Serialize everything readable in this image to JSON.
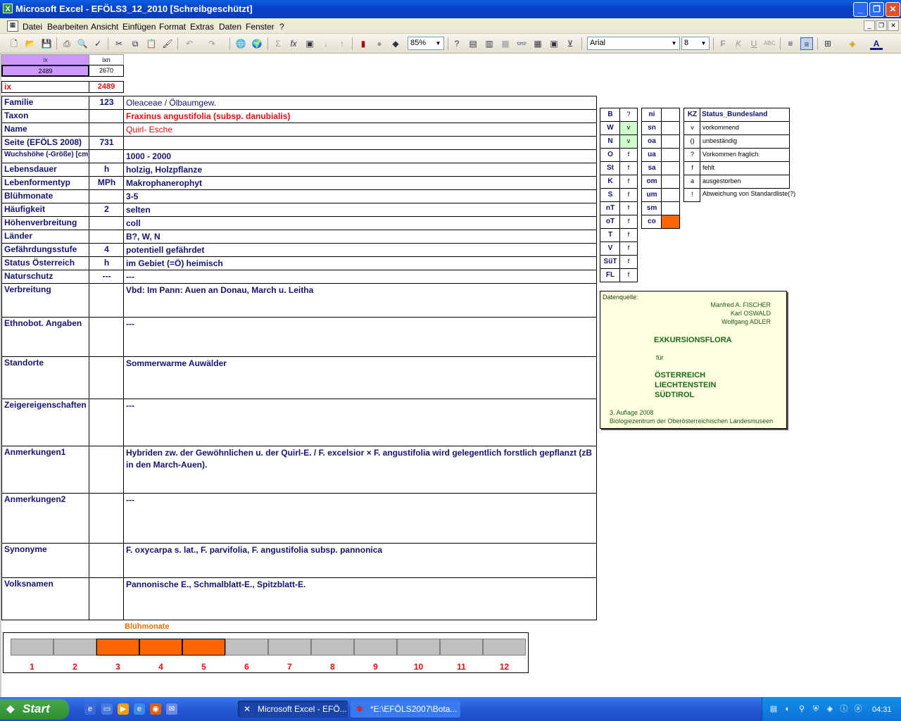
{
  "window": {
    "title": "Microsoft Excel - EFÖLS3_12_2010  [Schreibgeschützt]"
  },
  "menu": [
    "Datei",
    "Bearbeiten",
    "Ansicht",
    "Einfügen",
    "Format",
    "Extras",
    "Daten",
    "Fenster",
    "?"
  ],
  "toolbar": {
    "zoom": "85%",
    "font": "Arial",
    "font_size": "8"
  },
  "index": {
    "ix_header": "ix",
    "ixn_header": "ixn",
    "ix_value": "2489",
    "ixn_value": "2670",
    "ix_label": "ix",
    "ix_label_value": "2489"
  },
  "rows": [
    {
      "label": "Familie",
      "code": "123",
      "value": "Oleaceae  /  Ölbaumgew."
    },
    {
      "label": "Taxon",
      "code": "",
      "value": "Fraxinus angustifolia (subsp. danubialis)"
    },
    {
      "label": "Name",
      "code": "",
      "value": "Quirl- Esche"
    },
    {
      "label": "Seite (EFÖLS 2008)",
      "code": "731",
      "value": ""
    },
    {
      "label": "Wuchshöhe (-Größe) [cm]",
      "code": "",
      "value": "1000 - 2000"
    },
    {
      "label": "Lebensdauer",
      "code": "h",
      "value": "holzig, Holzpflanze"
    },
    {
      "label": "Lebenformentyp",
      "code": "MPh",
      "value": "Makrophanerophyt"
    },
    {
      "label": "Blühmonate",
      "code": "",
      "value": "3-5"
    },
    {
      "label": "Häufigkeit",
      "code": "2",
      "value": "selten"
    },
    {
      "label": "Höhenverbreitung",
      "code": "",
      "value": "coll"
    },
    {
      "label": "Länder",
      "code": "",
      "value": "B?, W, N"
    },
    {
      "label": "Gefährdungsstufe",
      "code": "4",
      "value": "potentiell gefährdet"
    },
    {
      "label": "Status Österreich",
      "code": "h",
      "value": "im Gebiet (=Ö) heimisch"
    },
    {
      "label": "Naturschutz",
      "code": "---",
      "value": "---"
    },
    {
      "label": "Verbreitung",
      "code": "",
      "value": "Vbd:  Im Pann: Auen an Donau, March u. Leitha"
    },
    {
      "label": "Ethnobot. Angaben",
      "code": "",
      "value": "---"
    },
    {
      "label": "Standorte",
      "code": "",
      "value": "Sommerwarme Auwälder"
    },
    {
      "label": "Zeigereigenschaften",
      "code": "",
      "value": "---"
    },
    {
      "label": "Anmerkungen1",
      "code": "",
      "value": "Hybriden zw. der Gewöhnlichen u. der Quirl-E. / F. excelsior × F. angustifolia wird gelegentlich forstlich gepflanzt (zB in den March-Auen)."
    },
    {
      "label": "Anmerkungen2",
      "code": "",
      "value": "---"
    },
    {
      "label": "Synonyme",
      "code": "",
      "value": "F. oxycarpa s. lat., F. parvifolia, F. angustifolia subsp. pannonica"
    },
    {
      "label": "Volksnamen",
      "code": "",
      "value": "Pannonische E., Schmalblatt-E., Spitzblatt-E."
    }
  ],
  "laender": [
    {
      "code": "B",
      "status": "?"
    },
    {
      "code": "W",
      "status": "v"
    },
    {
      "code": "N",
      "status": "v"
    },
    {
      "code": "O",
      "status": "f"
    },
    {
      "code": "St",
      "status": "f"
    },
    {
      "code": "K",
      "status": "f"
    },
    {
      "code": "S",
      "status": "f"
    },
    {
      "code": "nT",
      "status": "f"
    },
    {
      "code": "oT",
      "status": "f"
    },
    {
      "code": "T",
      "status": "f"
    },
    {
      "code": "V",
      "status": "f"
    },
    {
      "code": "SüT",
      "status": "f"
    },
    {
      "code": "FL",
      "status": "f"
    }
  ],
  "regionen": [
    "ni",
    "sn",
    "oa",
    "ua",
    "sa",
    "om",
    "um",
    "sm",
    "co"
  ],
  "legend": {
    "kz_header": "KZ",
    "title": "Status_Bundesland",
    "items": [
      {
        "code": "v",
        "text": "vorkommend"
      },
      {
        "code": "()",
        "text": "unbeständig"
      },
      {
        "code": "?",
        "text": "Vorkommen fraglich"
      },
      {
        "code": "f",
        "text": "fehlt"
      },
      {
        "code": "a",
        "text": "ausgestorben"
      },
      {
        "code": "!",
        "text": "Abweichung von Standardliste(?)"
      }
    ]
  },
  "source": {
    "label": "Datenquelle:",
    "authors": [
      "Manfred A. FISCHER",
      "Karl OSWALD",
      "Wolfgang ADLER"
    ],
    "title": "EXKURSIONSFLORA",
    "fuer": "für",
    "countries": [
      "ÖSTERREICH",
      "LIECHTENSTEIN",
      "SÜDTIROL"
    ],
    "edition": "3. Auflage 2008",
    "publisher": "Biologiezentrum der Oberösterreichischen Landesmuseen"
  },
  "bluehmonate": {
    "title": "Blühmonate",
    "months": [
      "1",
      "2",
      "3",
      "4",
      "5",
      "6",
      "7",
      "8",
      "9",
      "10",
      "11",
      "12"
    ],
    "active": [
      3,
      4,
      5
    ]
  },
  "taskbar": {
    "start": "Start",
    "tasks": [
      "Microsoft Excel - EFÖ...",
      "*E:\\EFÖLS2007\\Bota..."
    ],
    "clock": "04:31"
  }
}
